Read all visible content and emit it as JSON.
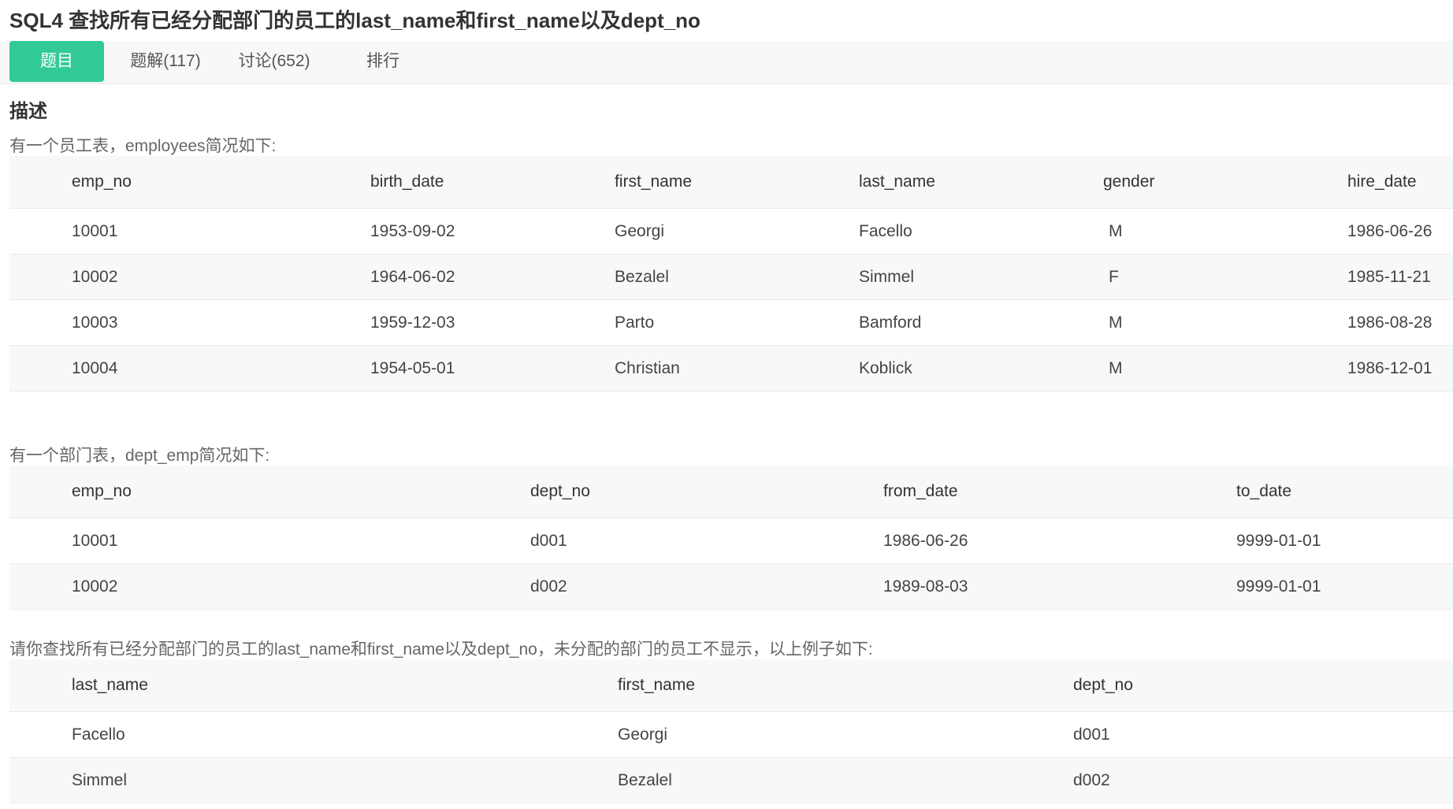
{
  "page_title": "SQL4  查找所有已经分配部门的员工的last_name和first_name以及dept_no",
  "tabs": [
    {
      "label": "题目",
      "active": true
    },
    {
      "label": "题解(117)",
      "active": false
    },
    {
      "label": "讨论(652)",
      "active": false
    },
    {
      "label": "排行",
      "active": false
    }
  ],
  "description": {
    "heading": "描述",
    "employees_caption": "有一个员工表，employees简况如下:",
    "dept_emp_caption": "有一个部门表，dept_emp简况如下:",
    "question_text": "请你查找所有已经分配部门的员工的last_name和first_name以及dept_no，未分配的部门的员工不显示，以上例子如下:"
  },
  "employees_table": {
    "headers": [
      "emp_no",
      "birth_date",
      "first_name",
      "last_name",
      "gender",
      "hire_date"
    ],
    "rows": [
      [
        "10001",
        "1953-09-02",
        "Georgi",
        "Facello",
        "M",
        "1986-06-26"
      ],
      [
        "10002",
        "1964-06-02",
        "Bezalel",
        "Simmel",
        "F",
        "1985-11-21"
      ],
      [
        "10003",
        "1959-12-03",
        "Parto",
        "Bamford",
        "M",
        "1986-08-28"
      ],
      [
        "10004",
        "1954-05-01",
        "Christian",
        "Koblick",
        "M",
        "1986-12-01"
      ]
    ]
  },
  "dept_emp_table": {
    "headers": [
      "emp_no",
      "dept_no",
      "from_date",
      "to_date"
    ],
    "rows": [
      [
        "10001",
        "d001",
        "1986-06-26",
        "9999-01-01"
      ],
      [
        "10002",
        "d002",
        "1989-08-03",
        "9999-01-01"
      ]
    ]
  },
  "result_table": {
    "headers": [
      "last_name",
      "first_name",
      "dept_no"
    ],
    "rows": [
      [
        "Facello",
        "Georgi",
        "d001"
      ],
      [
        "Simmel",
        "Bezalel",
        "d002"
      ]
    ]
  },
  "colors": {
    "accent": "#32ca99",
    "header_bg": "#f7f8fa",
    "border": "#ebebeb"
  }
}
